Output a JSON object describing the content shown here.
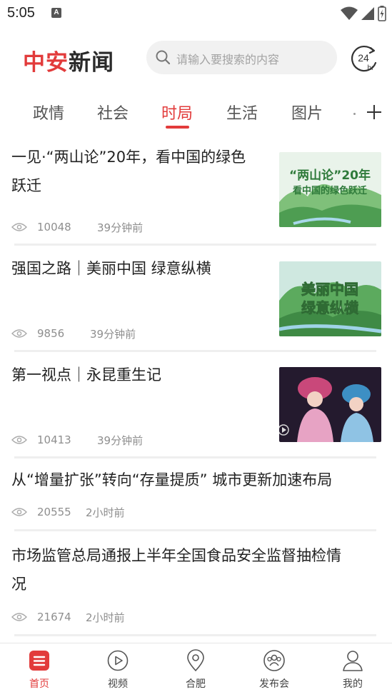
{
  "status_bar": {
    "time": "5:05",
    "notification_letter": "A"
  },
  "header": {
    "logo_part1": "中安",
    "logo_part2": "新闻",
    "search_placeholder": "请输入要搜索的内容",
    "clock_label_top": "24",
    "clock_label_bottom": "hr"
  },
  "tabs": {
    "items": [
      "政情",
      "社会",
      "时局",
      "生活",
      "图片"
    ],
    "active": "时局"
  },
  "news": [
    {
      "title_line1": "一见·“两山论”20年，看中国的绿色",
      "title_line2": "跃迁",
      "views": "10048",
      "time": "39分钟前",
      "image_caption_line1": "“两山论”20年",
      "image_caption_line2": "看中国的绿色跃迁"
    },
    {
      "title_line1": "强国之路｜美丽中国 绿意纵横",
      "views": "9856",
      "time": "39分钟前",
      "image_caption_line1": "美丽中国",
      "image_caption_line2": "绿意纵横"
    },
    {
      "title_line1": "第一视点｜永昆重生记",
      "views": "10413",
      "time": "39分钟前"
    },
    {
      "title_line1": "从“增量扩张”转向“存量提质” 城市更新加速布局",
      "views": "20555",
      "time": "2小时前"
    },
    {
      "title_line1": "市场监管总局通报上半年全国食品安全监督抽检情",
      "title_line2": "况",
      "views": "21674",
      "time": "2小时前"
    }
  ],
  "bottom_nav": [
    {
      "label": "首页",
      "icon": "home-list-icon",
      "active": true
    },
    {
      "label": "视频",
      "icon": "play-icon"
    },
    {
      "label": "合肥",
      "icon": "location-pin-icon"
    },
    {
      "label": "发布会",
      "icon": "people-icon"
    },
    {
      "label": "我的",
      "icon": "user-icon"
    }
  ],
  "colors": {
    "accent": "#e23b3b",
    "text": "#222222",
    "meta": "#8e8e8e"
  }
}
